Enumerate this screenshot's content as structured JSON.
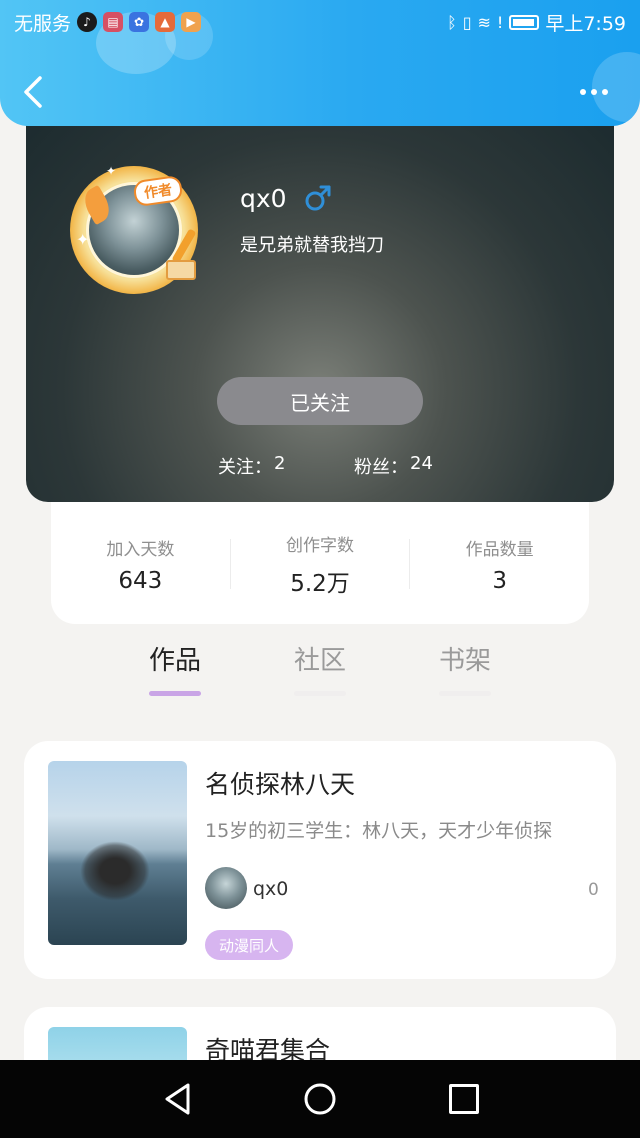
{
  "status_bar": {
    "carrier": "无服务",
    "time": "早上7:59",
    "app_icons": [
      "tiktok-icon",
      "red-app-icon",
      "paw-app-icon",
      "news-app-icon",
      "video-app-icon"
    ],
    "system_icons": [
      "bluetooth-icon",
      "vibrate-icon",
      "wifi-icon",
      "alert-icon",
      "battery-icon"
    ]
  },
  "header": {
    "back_icon": "chevron-left-icon",
    "more_icon": "more-dots-icon",
    "accent_color": "#2aa9f1"
  },
  "profile": {
    "username": "qx0",
    "gender_icon": "male-icon",
    "signature": "是兄弟就替我挡刀",
    "author_badge": "作者",
    "follow_button": "已关注",
    "following_label": "关注：",
    "following_count": "2",
    "fans_label": "粉丝：",
    "fans_count": "24"
  },
  "counts": [
    {
      "label": "加入天数",
      "value": "643"
    },
    {
      "label": "创作字数",
      "value": "5.2万"
    },
    {
      "label": "作品数量",
      "value": "3"
    }
  ],
  "tabs": [
    {
      "label": "作品",
      "active": true
    },
    {
      "label": "社区",
      "active": false
    },
    {
      "label": "书架",
      "active": false
    }
  ],
  "works": [
    {
      "title": "名侦探林八天",
      "description": "15岁的初三学生：林八天，天才少年侦探",
      "author": "qx0",
      "count": "0",
      "tag": "动漫同人",
      "tag_color": "#d7b5f0"
    },
    {
      "title": "奇喵君集合"
    }
  ],
  "system_nav": {
    "back": "triangle-back-icon",
    "home": "circle-home-icon",
    "recent": "square-recent-icon"
  }
}
